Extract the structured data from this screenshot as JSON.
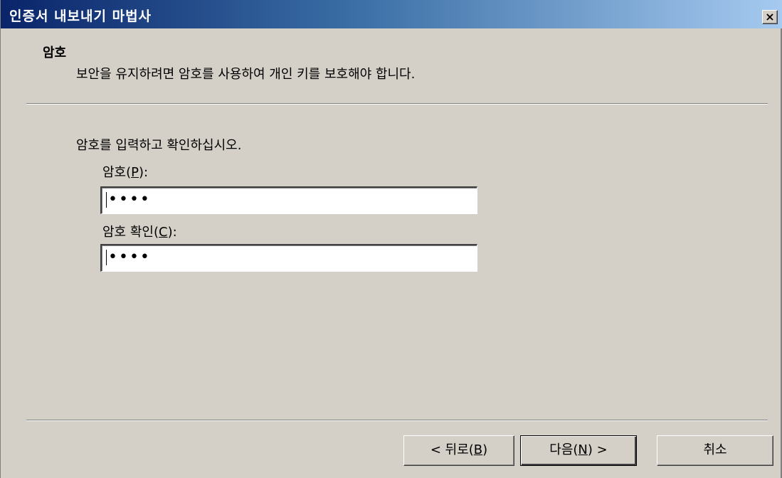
{
  "window": {
    "title": "인증서 내보내기 마법사",
    "close_label": "×"
  },
  "header": {
    "title": "암호",
    "subtitle": "보안을 유지하려면 암호를 사용하여 개인 키를 보호해야 합니다."
  },
  "body": {
    "instruction": "암호를 입력하고 확인하십시오.",
    "password_label": "암호(",
    "password_accel": "P",
    "password_label_end": "):",
    "password_value": "••••",
    "confirm_label": "암호 확인(",
    "confirm_accel": "C",
    "confirm_label_end": "):",
    "confirm_value": "••••"
  },
  "buttons": {
    "back_pre": "< 뒤로(",
    "back_accel": "B",
    "back_post": ")",
    "next_pre": "다음(",
    "next_accel": "N",
    "next_post": ") >",
    "cancel": "취소"
  }
}
